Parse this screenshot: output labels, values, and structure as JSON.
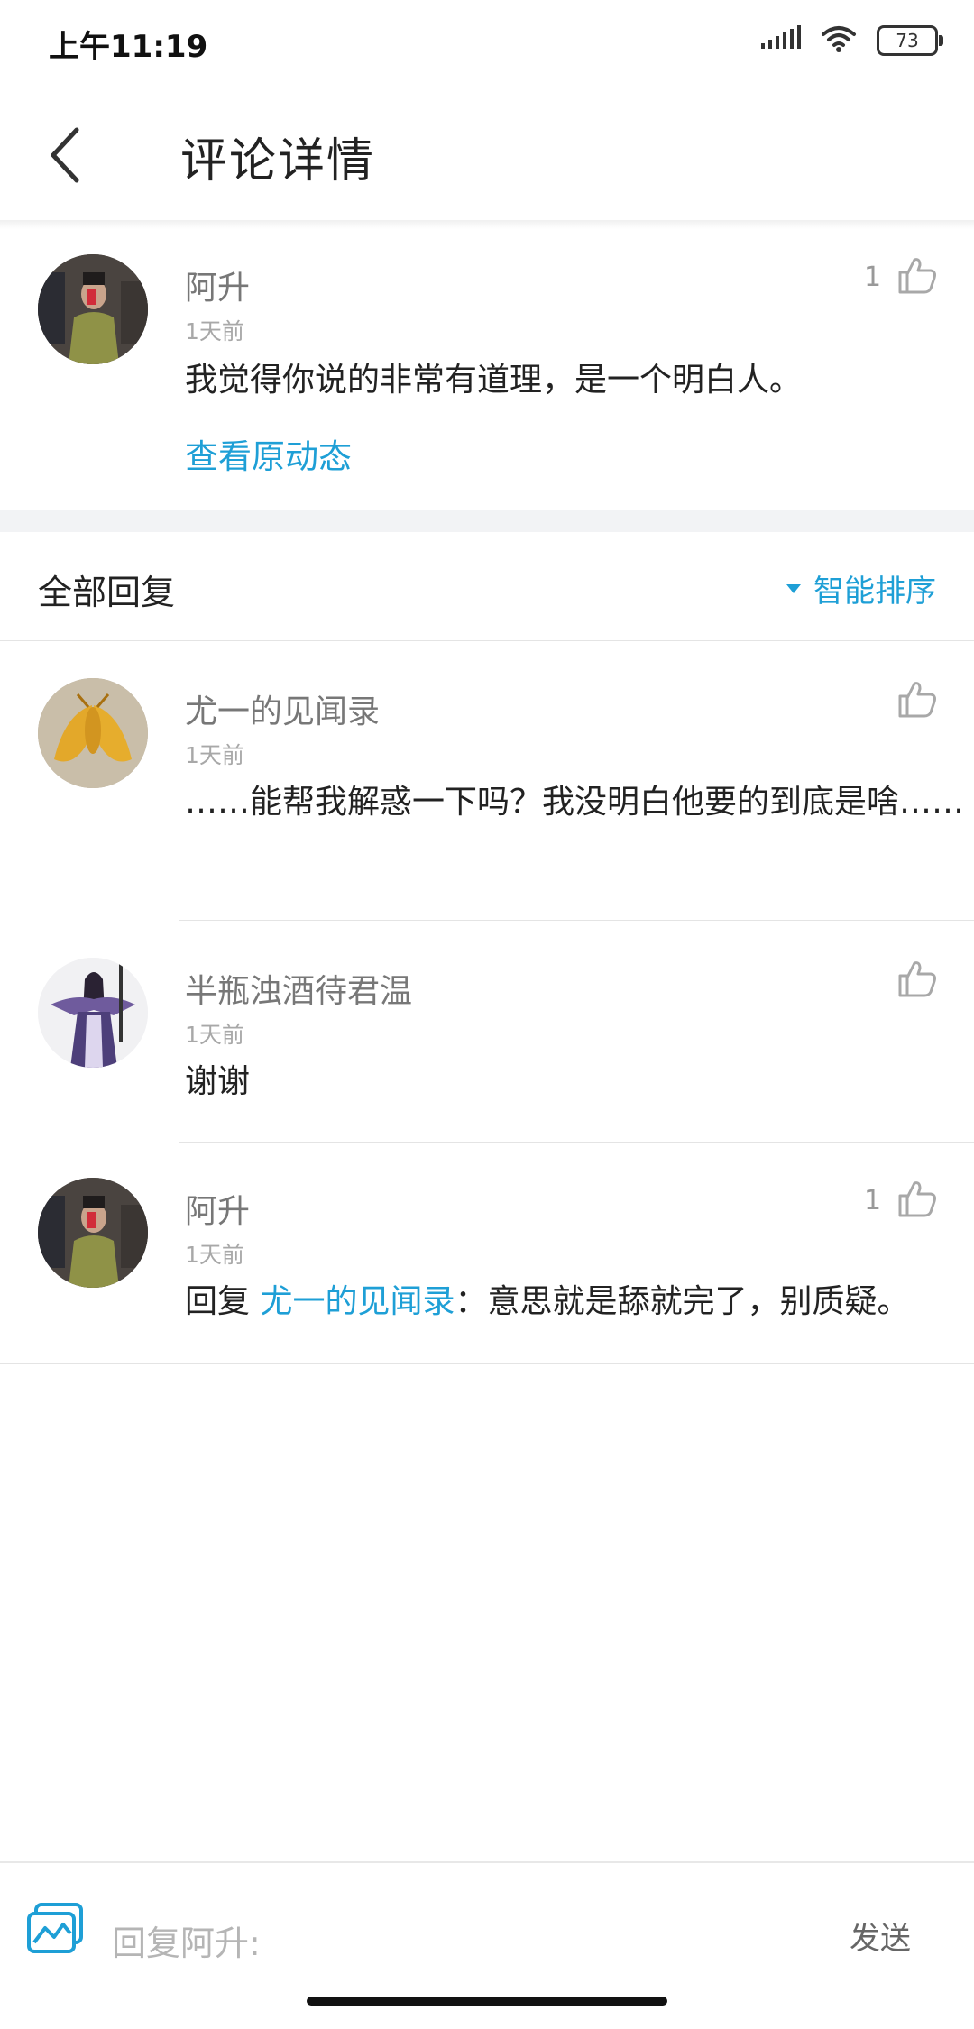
{
  "status_bar": {
    "time": "上午11:19",
    "battery": "73"
  },
  "header": {
    "title": "评论详情"
  },
  "main_comment": {
    "user": "阿升",
    "time": "1天前",
    "likes": "1",
    "text": "我觉得你说的非常有道理，是一个明白人。",
    "view_original": "查看原动态"
  },
  "replies_section": {
    "title": "全部回复",
    "sort_label": "智能排序"
  },
  "replies": [
    {
      "user": "尤一的见闻录",
      "time": "1天前",
      "likes": "",
      "text": "……能帮我解惑一下吗？我没明白他要的到底是啥……"
    },
    {
      "user": "半瓶浊酒待君温",
      "time": "1天前",
      "likes": "",
      "text": "谢谢"
    },
    {
      "user": "阿升",
      "time": "1天前",
      "likes": "1",
      "prefix": "回复 ",
      "mention": "尤一的见闻录",
      "text": "：意思就是舔就完了，别质疑。"
    }
  ],
  "bottom_bar": {
    "placeholder": "回复阿升:",
    "send_label": "发送"
  },
  "colors": {
    "accent": "#1e9fd6",
    "divider": "#e4e4e4",
    "band": "#f2f3f5"
  }
}
